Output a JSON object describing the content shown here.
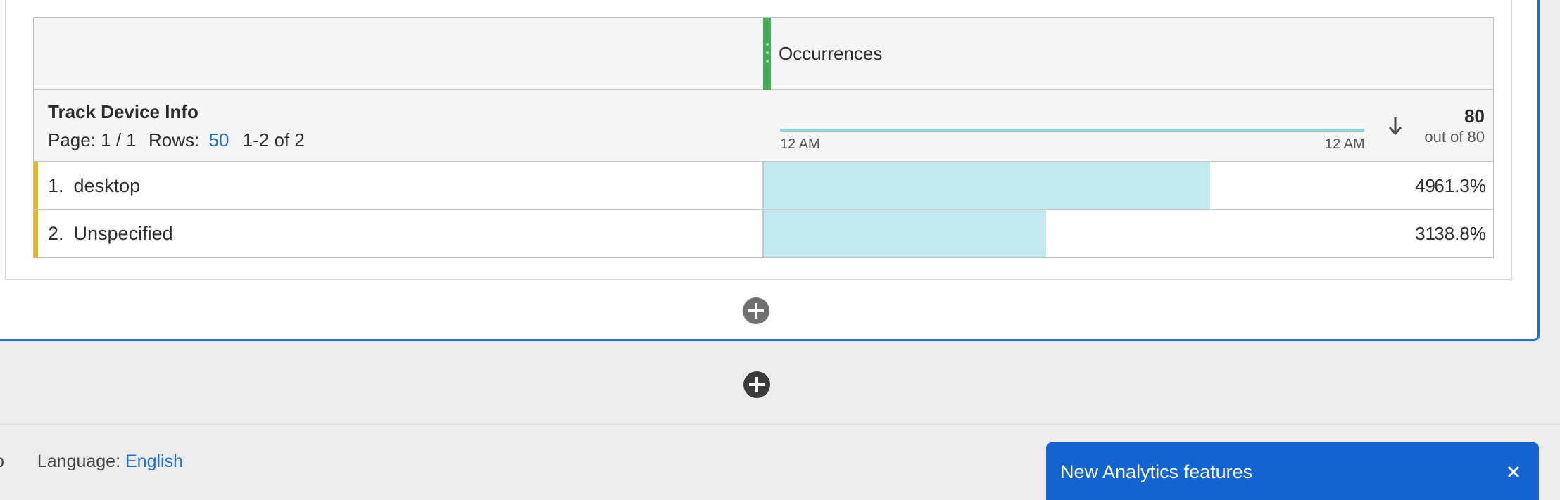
{
  "table": {
    "metric_title": "Occurrences",
    "dimension_title": "Track Device Info",
    "pager": {
      "page_label": "Page: 1 / 1",
      "rows_label": "Rows:",
      "rows_value": "50",
      "range_label": "1-2 of 2"
    },
    "sparkline": {
      "start_tick": "12 AM",
      "end_tick": "12 AM"
    },
    "total": "80",
    "total_of": "out of 80",
    "rows": [
      {
        "num": "1.",
        "label": "desktop",
        "value": "49",
        "percent": "61.3%",
        "share": 0.613
      },
      {
        "num": "2.",
        "label": "Unspecified",
        "value": "31",
        "percent": "38.8%",
        "share": 0.388
      }
    ]
  },
  "footer": {
    "help_text": "p",
    "language_label": "Language:",
    "language_value": "English"
  },
  "toast": {
    "message": "New Analytics features"
  },
  "colors": {
    "accent_blue": "#1d6fd4",
    "metric_green": "#3fae57",
    "bar_cyan": "#c2e9ed",
    "row_accent": "#e3b72a",
    "toast_blue": "#1363d1"
  }
}
